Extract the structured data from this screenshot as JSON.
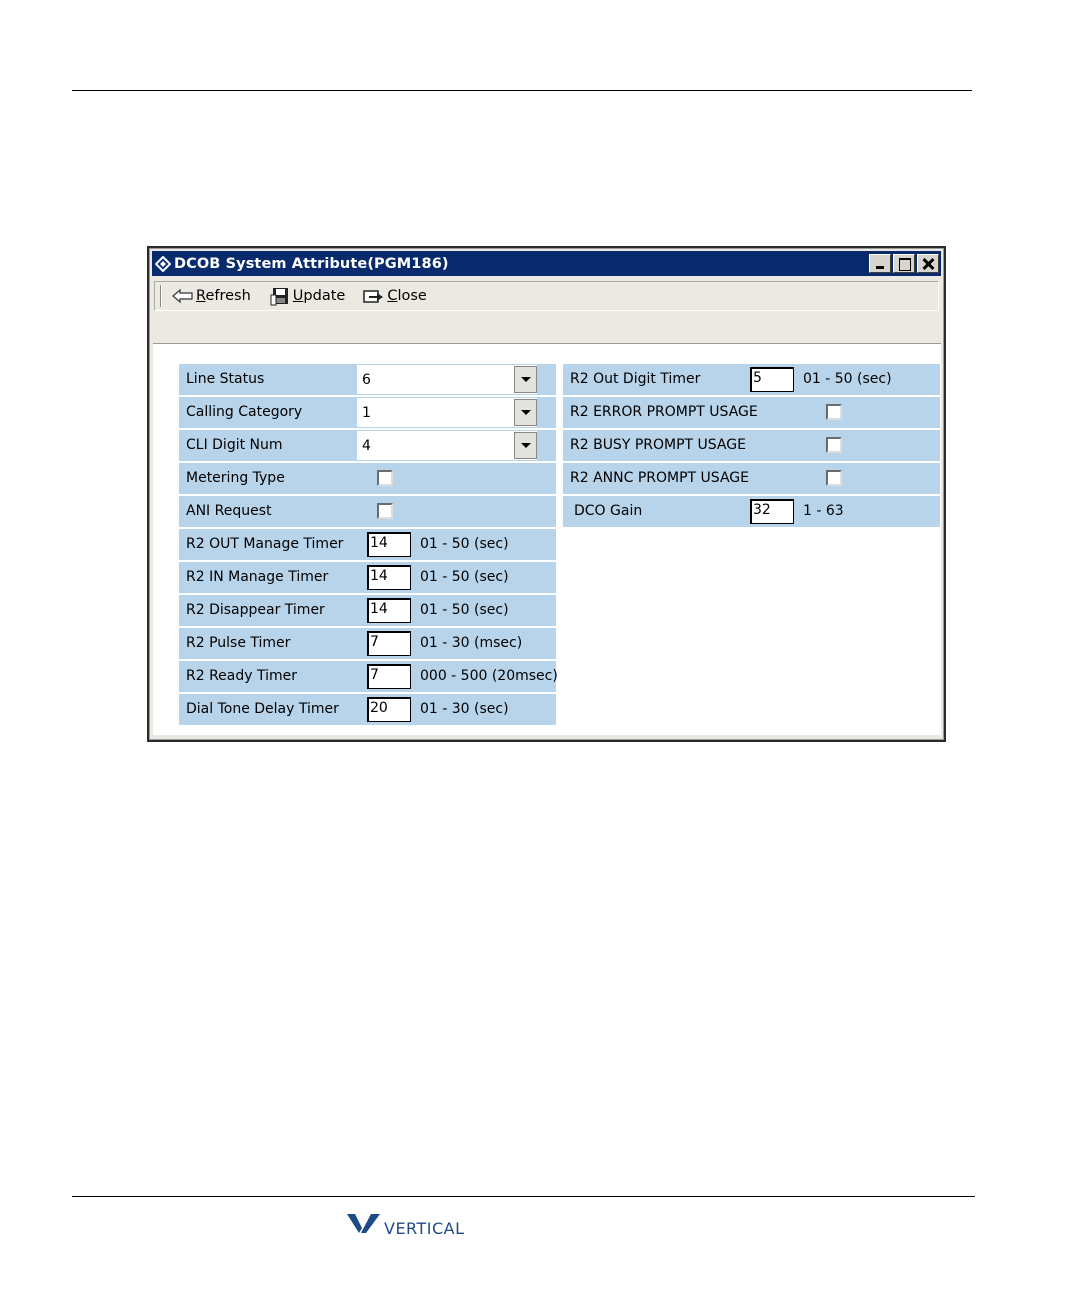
{
  "window": {
    "title": "DCOB System Attribute(PGM186)",
    "toolbar": {
      "refresh_label": "Refresh",
      "update_label": "Update",
      "close_label": "Close"
    }
  },
  "left_fields": {
    "line_status": {
      "label": "Line Status",
      "value": "6"
    },
    "calling_category": {
      "label": "Calling Category",
      "value": "1"
    },
    "cli_digit_num": {
      "label": "CLI Digit Num",
      "value": "4"
    },
    "metering_type": {
      "label": "Metering Type",
      "checked": false
    },
    "ani_request": {
      "label": "ANI Request",
      "checked": false
    },
    "r2_out_manage_timer": {
      "label": "R2 OUT Manage Timer",
      "value": "14",
      "range": "01 - 50 (sec)"
    },
    "r2_in_manage_timer": {
      "label": "R2 IN Manage Timer",
      "value": "14",
      "range": "01 - 50 (sec)"
    },
    "r2_disappear_timer": {
      "label": "R2 Disappear Timer",
      "value": "14",
      "range": "01 - 50 (sec)"
    },
    "r2_pulse_timer": {
      "label": "R2 Pulse Timer",
      "value": "7",
      "range": "01 - 30 (msec)"
    },
    "r2_ready_timer": {
      "label": "R2 Ready Timer",
      "value": "7",
      "range": "000 - 500 (20msec)"
    },
    "dial_tone_delay_timer": {
      "label": "Dial Tone Delay Timer",
      "value": "20",
      "range": "01 - 30 (sec)"
    }
  },
  "right_fields": {
    "r2_out_digit_timer": {
      "label": "R2 Out Digit Timer",
      "value": "5",
      "range": "01 - 50 (sec)"
    },
    "r2_error_prompt_usage": {
      "label": "R2 ERROR PROMPT USAGE",
      "checked": false
    },
    "r2_busy_prompt_usage": {
      "label": "R2 BUSY PROMPT USAGE",
      "checked": false
    },
    "r2_annc_prompt_usage": {
      "label": "R2 ANNC PROMPT USAGE",
      "checked": false
    },
    "dco_gain": {
      "label": "DCO Gain",
      "value": "32",
      "range": "1 - 63"
    }
  },
  "footer": {
    "logo_text": "VERTICAL",
    "brand_color": "#1e4a86"
  },
  "colors": {
    "title_bar": "#0a2a6e",
    "row_background": "#b8d4ea"
  }
}
